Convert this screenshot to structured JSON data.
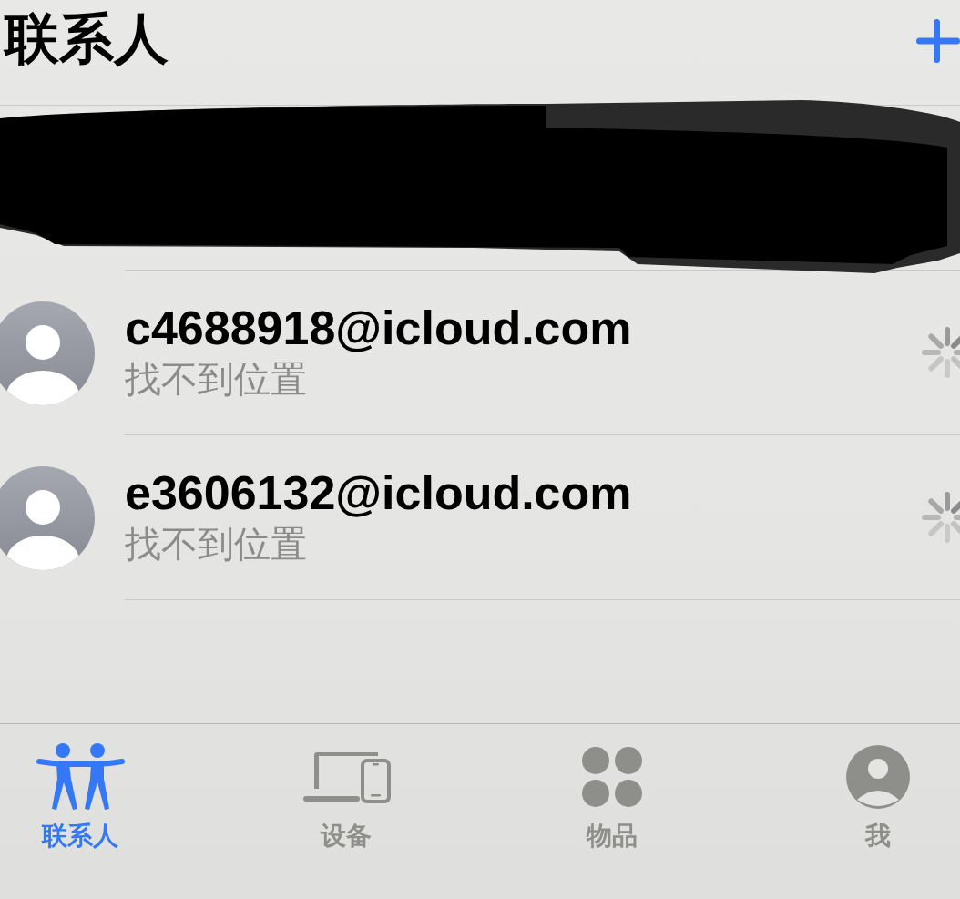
{
  "header": {
    "title": "联系人"
  },
  "contacts": [
    {
      "email": "c4688918@icloud.com",
      "status": "找不到位置",
      "loading": true
    },
    {
      "email": "e3606132@icloud.com",
      "status": "找不到位置",
      "loading": true
    }
  ],
  "tab_bar": {
    "tabs": [
      {
        "label": "联系人",
        "kind": "people",
        "selected": true
      },
      {
        "label": "设备",
        "kind": "devices",
        "selected": false
      },
      {
        "label": "物品",
        "kind": "items",
        "selected": false
      },
      {
        "label": "我",
        "kind": "me",
        "selected": false
      }
    ]
  }
}
